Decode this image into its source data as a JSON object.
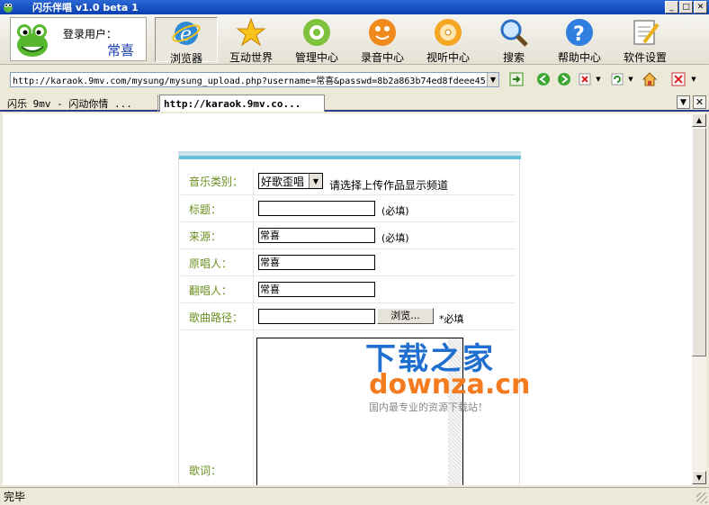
{
  "window": {
    "title": "闪乐伴唱 v1.0 beta 1"
  },
  "user": {
    "label": "登录用户：",
    "name": "常喜"
  },
  "toolbar": {
    "items": [
      {
        "label": "浏览器",
        "icon": "ie-browser-icon"
      },
      {
        "label": "互动世界",
        "icon": "star-icon"
      },
      {
        "label": "管理中心",
        "icon": "gear-icon"
      },
      {
        "label": "录音中心",
        "icon": "microphone-icon"
      },
      {
        "label": "视听中心",
        "icon": "cd-icon"
      },
      {
        "label": "搜索",
        "icon": "magnifier-icon"
      },
      {
        "label": "帮助中心",
        "icon": "help-icon"
      },
      {
        "label": "软件设置",
        "icon": "settings-icon"
      }
    ]
  },
  "address": {
    "url": "http://karaok.9mv.com/mysung/mysung_upload.php?username=常喜&passwd=8b2a863b74ed8fdeee45"
  },
  "tabs": [
    {
      "label": "闪乐 9mv - 闪动你情 ..."
    },
    {
      "label": "http://karaok.9mv.co..."
    }
  ],
  "form": {
    "category_label": "音乐类别：",
    "category_value": "好歌歪唱",
    "category_hint": "请选择上传作品显示频道",
    "title_label": "标题：",
    "title_value": "",
    "title_hint": "(必填)",
    "source_label": "来源：",
    "source_value": "常喜",
    "source_hint": "(必填)",
    "original_label": "原唱人：",
    "original_value": "常喜",
    "cover_label": "翻唱人：",
    "cover_value": "常喜",
    "path_label": "歌曲路径：",
    "path_value": "",
    "browse_label": "浏览...",
    "path_hint": "*必填",
    "lyrics_label": "歌词："
  },
  "watermark": {
    "line1": "下载之家",
    "line2": "downza.cn",
    "line3": "国内最专业的资源下载站！"
  },
  "status": {
    "text": "完毕"
  },
  "colors": {
    "titlebar": "#0a3fb0",
    "form_label": "#6a8f1f",
    "form_accent": "#66c2dc"
  }
}
